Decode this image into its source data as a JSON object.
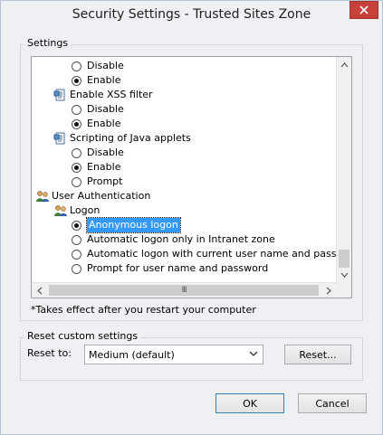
{
  "window": {
    "title": "Security Settings - Trusted Sites Zone",
    "close_symbol": "✕"
  },
  "settings_group": {
    "label": "Settings",
    "rows": [
      {
        "kind": "radio",
        "label": "Disable",
        "checked": false
      },
      {
        "kind": "radio",
        "label": "Enable",
        "checked": true
      },
      {
        "kind": "category",
        "label": "Enable XSS filter",
        "icon": "settings-page-icon"
      },
      {
        "kind": "radio",
        "label": "Disable",
        "checked": false
      },
      {
        "kind": "radio",
        "label": "Enable",
        "checked": true
      },
      {
        "kind": "category",
        "label": "Scripting of Java applets",
        "icon": "settings-page-icon"
      },
      {
        "kind": "radio",
        "label": "Disable",
        "checked": false
      },
      {
        "kind": "radio",
        "label": "Enable",
        "checked": true
      },
      {
        "kind": "radio",
        "label": "Prompt",
        "checked": false
      },
      {
        "kind": "category",
        "label": "User Authentication",
        "icon": "users-icon"
      },
      {
        "kind": "category",
        "label": "Logon",
        "icon": "users-icon"
      },
      {
        "kind": "radio",
        "label": "Anonymous logon",
        "checked": true,
        "selected": true
      },
      {
        "kind": "radio",
        "label": "Automatic logon only in Intranet zone",
        "checked": false
      },
      {
        "kind": "radio",
        "label": "Automatic logon with current user name and password",
        "checked": false
      },
      {
        "kind": "radio",
        "label": "Prompt for user name and password",
        "checked": false
      }
    ],
    "note": "*Takes effect after you restart your computer",
    "hscroll_grip": "III"
  },
  "reset_group": {
    "label": "Reset custom settings",
    "reset_to_label": "Reset to:",
    "selected_level": "Medium (default)",
    "reset_button": "Reset..."
  },
  "footer": {
    "ok_button": "OK",
    "cancel_button": "Cancel"
  }
}
